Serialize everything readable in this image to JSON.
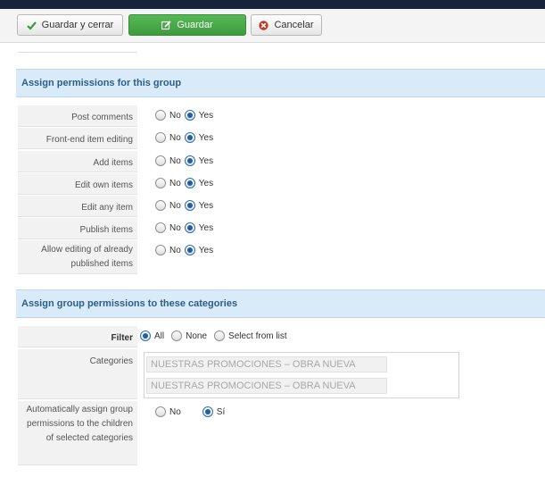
{
  "toolbar": {
    "save_close_label": "Guardar y cerrar",
    "save_label": "Guardar",
    "cancel_label": "Cancelar"
  },
  "sections": {
    "permissions_title": "Assign permissions for this group",
    "categories_title": "Assign group permissions to these categories"
  },
  "permissions": [
    {
      "label": "Post comments",
      "value": "Yes"
    },
    {
      "label": "Front-end item editing",
      "value": "Yes"
    },
    {
      "label": "Add items",
      "value": "Yes"
    },
    {
      "label": "Edit own items",
      "value": "Yes"
    },
    {
      "label": "Edit any item",
      "value": "Yes"
    },
    {
      "label": "Publish items",
      "value": "Yes"
    },
    {
      "label": "Allow editing of already published items",
      "value": "Yes"
    }
  ],
  "options": {
    "no": "No",
    "yes": "Yes",
    "si": "Sí"
  },
  "filter": {
    "label": "Filter",
    "all": "All",
    "none": "None",
    "select": "Select from list",
    "selected": "All"
  },
  "categories": {
    "label": "Categories",
    "items": [
      "NUESTRAS PROMOCIONES – OBRA NUEVA",
      "NUESTRAS PROMOCIONES – OBRA NUEVA"
    ]
  },
  "auto_assign": {
    "label": "Automatically assign group permissions to the children of selected categories",
    "selected": "Sí"
  },
  "colors": {
    "accent_green": "#46a546",
    "section_bg": "#d9eaf8",
    "section_text": "#2b5f8a",
    "cancel_red": "#c0392b"
  }
}
